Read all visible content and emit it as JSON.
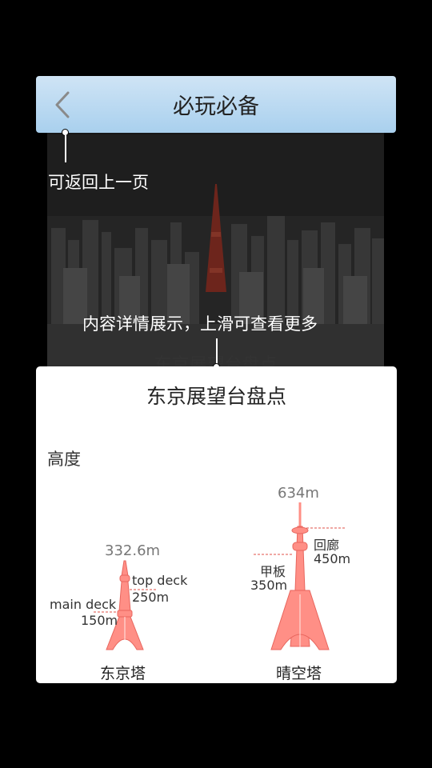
{
  "header": {
    "title": "必玩必备"
  },
  "photo": {
    "caption": "东京展望台盘点"
  },
  "annotations": {
    "back": "可返回上一页",
    "content": "内容详情展示，上滑可查看更多"
  },
  "card": {
    "title": "东京展望台盘点",
    "section": "高度",
    "towers": [
      {
        "name": "东京塔",
        "height": "332.6m",
        "decks": [
          {
            "name": "top deck",
            "height": "250m"
          },
          {
            "name": "main deck",
            "height": "150m"
          }
        ]
      },
      {
        "name": "晴空塔",
        "height": "634m",
        "decks": [
          {
            "name": "回廊",
            "height": "450m"
          },
          {
            "name": "甲板",
            "height": "350m"
          }
        ]
      }
    ]
  },
  "colors": {
    "tower": "#ff8f86",
    "dash": "#e0504a",
    "header": "#b6d8f1"
  }
}
